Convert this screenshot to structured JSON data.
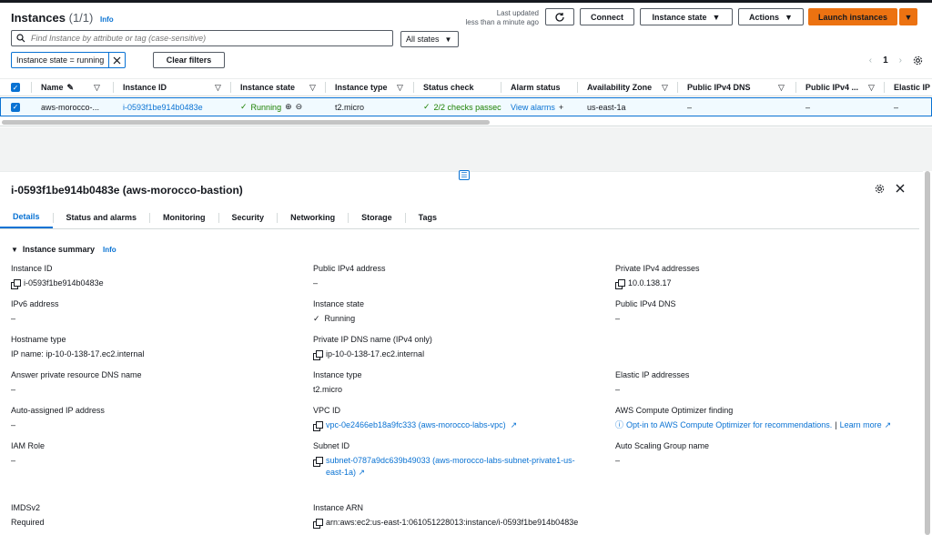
{
  "header": {
    "title": "Instances",
    "count": "(1/1)",
    "info": "Info",
    "last_updated_line1": "Last updated",
    "last_updated_line2": "less than a minute ago",
    "connect": "Connect",
    "instance_state": "Instance state",
    "actions": "Actions",
    "launch": "Launch instances"
  },
  "search": {
    "placeholder": "Find Instance by attribute or tag (case-sensitive)"
  },
  "states_select": "All states",
  "filter_token": "Instance state = running",
  "clear_filters": "Clear filters",
  "pager": {
    "page": "1"
  },
  "table": {
    "headers": [
      "Name",
      "Instance ID",
      "Instance state",
      "Instance type",
      "Status check",
      "Alarm status",
      "Availability Zone",
      "Public IPv4 DNS",
      "Public IPv4 ...",
      "Elastic IP"
    ],
    "row": {
      "name": "aws-morocco-...",
      "id": "i-0593f1be914b0483e",
      "state": "Running",
      "type": "t2.micro",
      "status": "2/2 checks passec",
      "alarm": "View alarms",
      "az": "us-east-1a",
      "dns": "–",
      "ipv4": "–",
      "eip": "–"
    }
  },
  "detail": {
    "title": "i-0593f1be914b0483e (aws-morocco-bastion)",
    "tabs": [
      "Details",
      "Status and alarms",
      "Monitoring",
      "Security",
      "Networking",
      "Storage",
      "Tags"
    ],
    "summary": "Instance summary",
    "info": "Info",
    "col1": [
      {
        "label": "Instance ID",
        "value": "i-0593f1be914b0483e"
      },
      {
        "label": "IPv6 address",
        "value": "–"
      },
      {
        "label": "Hostname type",
        "value": "IP name: ip-10-0-138-17.ec2.internal"
      },
      {
        "label": "Answer private resource DNS name",
        "value": "–"
      },
      {
        "label": "Auto-assigned IP address",
        "value": "–"
      },
      {
        "label": "IAM Role",
        "value": "–"
      },
      {
        "label": "IMDSv2",
        "value": "Required"
      }
    ],
    "col2": [
      {
        "label": "Public IPv4 address",
        "value": "–"
      },
      {
        "label": "Instance state",
        "value": "Running"
      },
      {
        "label": "Private IP DNS name (IPv4 only)",
        "value": "ip-10-0-138-17.ec2.internal"
      },
      {
        "label": "Instance type",
        "value": "t2.micro"
      },
      {
        "label": "VPC ID",
        "value": "vpc-0e2466eb18a9fc333 (aws-morocco-labs-vpc)"
      },
      {
        "label": "Subnet ID",
        "value1": "subnet-0787a9dc639b49033 (aws-morocco-labs-subnet-private1-us-",
        "value2": "east-1a)"
      },
      {
        "label": "Instance ARN",
        "value": "arn:aws:ec2:us-east-1:061051228013:instance/i-0593f1be914b0483e"
      }
    ],
    "col3": [
      {
        "label": "Private IPv4 addresses",
        "value": "10.0.138.17"
      },
      {
        "label": "Public IPv4 DNS",
        "value": "–"
      },
      {
        "label": "Elastic IP addresses",
        "value": "–"
      },
      {
        "label": "AWS Compute Optimizer finding",
        "value": "Opt-in to AWS Compute Optimizer for recommendations.",
        "learn": "Learn more"
      },
      {
        "label": "Auto Scaling Group name",
        "value": "–"
      }
    ]
  },
  "colors": {
    "accent": "#0972d3",
    "orange": "#ec7211",
    "green": "#1d8102"
  }
}
